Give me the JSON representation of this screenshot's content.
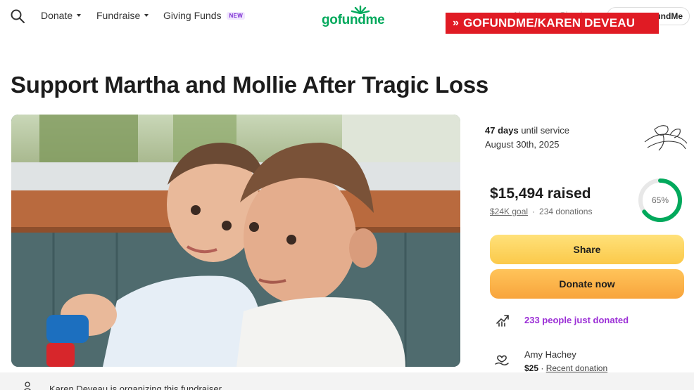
{
  "nav": {
    "donate": "Donate",
    "fundraise": "Fundraise",
    "giving_funds": "Giving Funds",
    "new_badge": "NEW",
    "logo": "gofundme",
    "signin_partial": "FundMe"
  },
  "credit_banner": {
    "arrows": "»",
    "text": "GOFUNDME/KAREN DEVEAU"
  },
  "campaign": {
    "title": "Support Martha and Mollie After Tragic Loss"
  },
  "service": {
    "days": "47 days",
    "days_suffix": "until service",
    "date": "August 30th, 2025"
  },
  "progress": {
    "raised": "$15,494 raised",
    "goal": "$24K goal",
    "separator": "·",
    "donations": "234 donations",
    "percent_label": "65%",
    "percent_value": 0.65,
    "ring_color": "#02a95c"
  },
  "actions": {
    "share": "Share",
    "donate_now": "Donate now"
  },
  "activity": {
    "text": "233 people just donated",
    "icon": "trending-up-icon"
  },
  "recent_donor": {
    "name": "Amy Hachey",
    "amount": "$25",
    "separator": "·",
    "tag": "Recent donation",
    "icon": "donation-icon"
  },
  "organizer": {
    "text": "Karen Deveau is organizing this fundraiser"
  },
  "colors": {
    "brand_green": "#02a95c",
    "purple": "#9b2ed6",
    "credit_red": "#e01b24"
  }
}
